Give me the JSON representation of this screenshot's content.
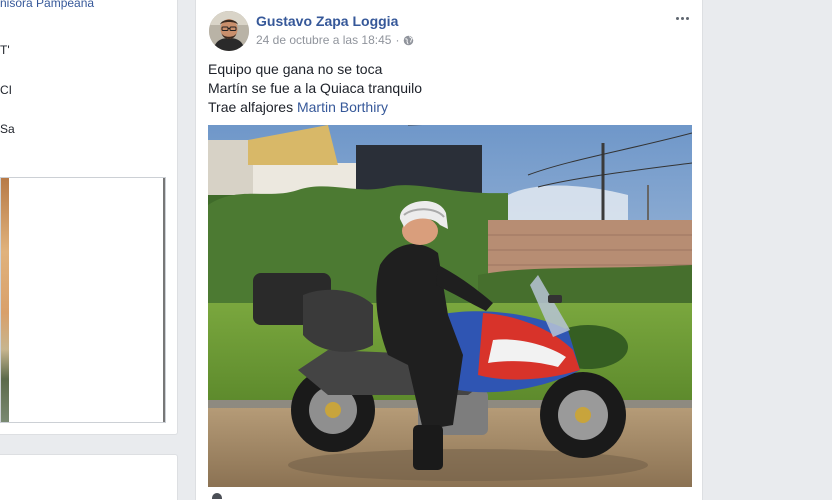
{
  "left_column": {
    "page_name_fragment": "nisora Pampeana",
    "fragment_1": "T'",
    "fragment_2": "CI",
    "fragment_3": "Sa"
  },
  "post": {
    "author": "Gustavo Zapa Loggia",
    "timestamp": "24 de octubre a las 18:45",
    "separator": "·",
    "privacy_icon": "globe-icon",
    "more_icon": "more-options-icon",
    "lines": [
      "Equipo que gana no se toca",
      "Martín se fue a la Quiaca tranquilo"
    ],
    "line3_prefix": "Trae alfajores ",
    "mention": "Martin Borthiry",
    "photo_description_label": "Hombre con casco sobre una moto Honda Varadero"
  },
  "colors": {
    "link": "#365899",
    "text": "#1d2129",
    "meta": "#90949c",
    "background": "#e9ebee"
  }
}
